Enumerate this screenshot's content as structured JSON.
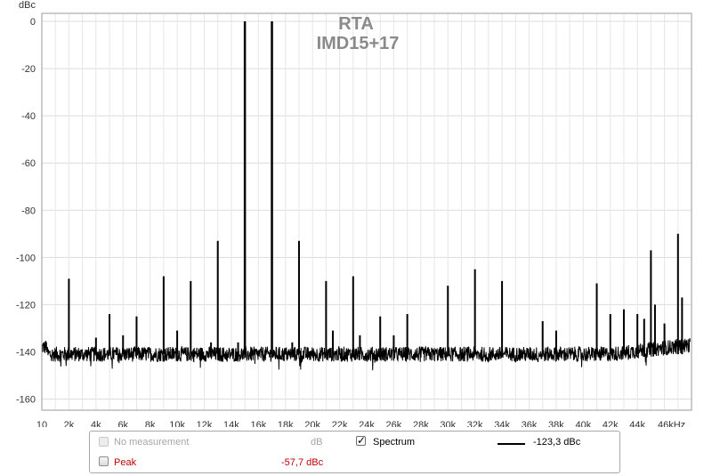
{
  "chart_data": {
    "type": "line",
    "title": "RTA",
    "subtitle": "IMD15+17",
    "ylabel": "dBc",
    "xlabel": "",
    "xlim": [
      0,
      48000
    ],
    "ylim": [
      -165,
      2
    ],
    "y_ticks": [
      0,
      -20,
      -40,
      -60,
      -80,
      -100,
      -120,
      -140,
      -160
    ],
    "y_tick_labels": [
      "0",
      "-20",
      "-40",
      "-60",
      "-80",
      "-100",
      "-120",
      "-140",
      "-160"
    ],
    "x_ticks": [
      10,
      2000,
      4000,
      6000,
      8000,
      10000,
      12000,
      14000,
      16000,
      18000,
      20000,
      22000,
      24000,
      26000,
      28000,
      30000,
      32000,
      34000,
      36000,
      38000,
      40000,
      42000,
      44000,
      46000
    ],
    "x_tick_labels": [
      "10",
      "2k",
      "4k",
      "6k",
      "8k",
      "10k",
      "12k",
      "14k",
      "16k",
      "18k",
      "20k",
      "22k",
      "24k",
      "26k",
      "28k",
      "30k",
      "32k",
      "34k",
      "36k",
      "38k",
      "40k",
      "42k",
      "44k",
      "46kHz"
    ],
    "grid": true,
    "noise_floor": -141,
    "series": [
      {
        "name": "Spectrum",
        "color": "#000000",
        "peaks": [
          [
            2000,
            -109
          ],
          [
            4000,
            -134
          ],
          [
            5000,
            -124
          ],
          [
            6000,
            -133
          ],
          [
            7000,
            -125
          ],
          [
            9000,
            -108
          ],
          [
            10000,
            -131
          ],
          [
            11000,
            -110
          ],
          [
            12500,
            -136
          ],
          [
            13000,
            -93
          ],
          [
            14500,
            -136
          ],
          [
            15000,
            0
          ],
          [
            17000,
            0
          ],
          [
            18500,
            -136
          ],
          [
            19000,
            -93
          ],
          [
            21000,
            -110
          ],
          [
            21500,
            -131
          ],
          [
            23000,
            -108
          ],
          [
            23500,
            -133
          ],
          [
            25000,
            -125
          ],
          [
            26000,
            -133
          ],
          [
            27000,
            -124
          ],
          [
            30000,
            -112
          ],
          [
            32000,
            -105
          ],
          [
            34000,
            -110
          ],
          [
            37000,
            -127
          ],
          [
            38000,
            -131
          ],
          [
            41000,
            -111
          ],
          [
            42000,
            -124
          ],
          [
            43000,
            -122
          ],
          [
            44000,
            -124
          ],
          [
            44500,
            -126
          ],
          [
            45000,
            -97
          ],
          [
            45300,
            -120
          ],
          [
            46000,
            -128
          ],
          [
            47000,
            -90
          ],
          [
            47300,
            -117
          ]
        ]
      }
    ]
  },
  "legend": {
    "no_measurement_label": "No measurement",
    "no_measurement_unit": "dB",
    "spectrum_label": "Spectrum",
    "spectrum_value": "-123,3 dBc",
    "peak_label": "Peak",
    "peak_value": "-57,7 dBc",
    "spectrum_check_mark": "✓"
  }
}
